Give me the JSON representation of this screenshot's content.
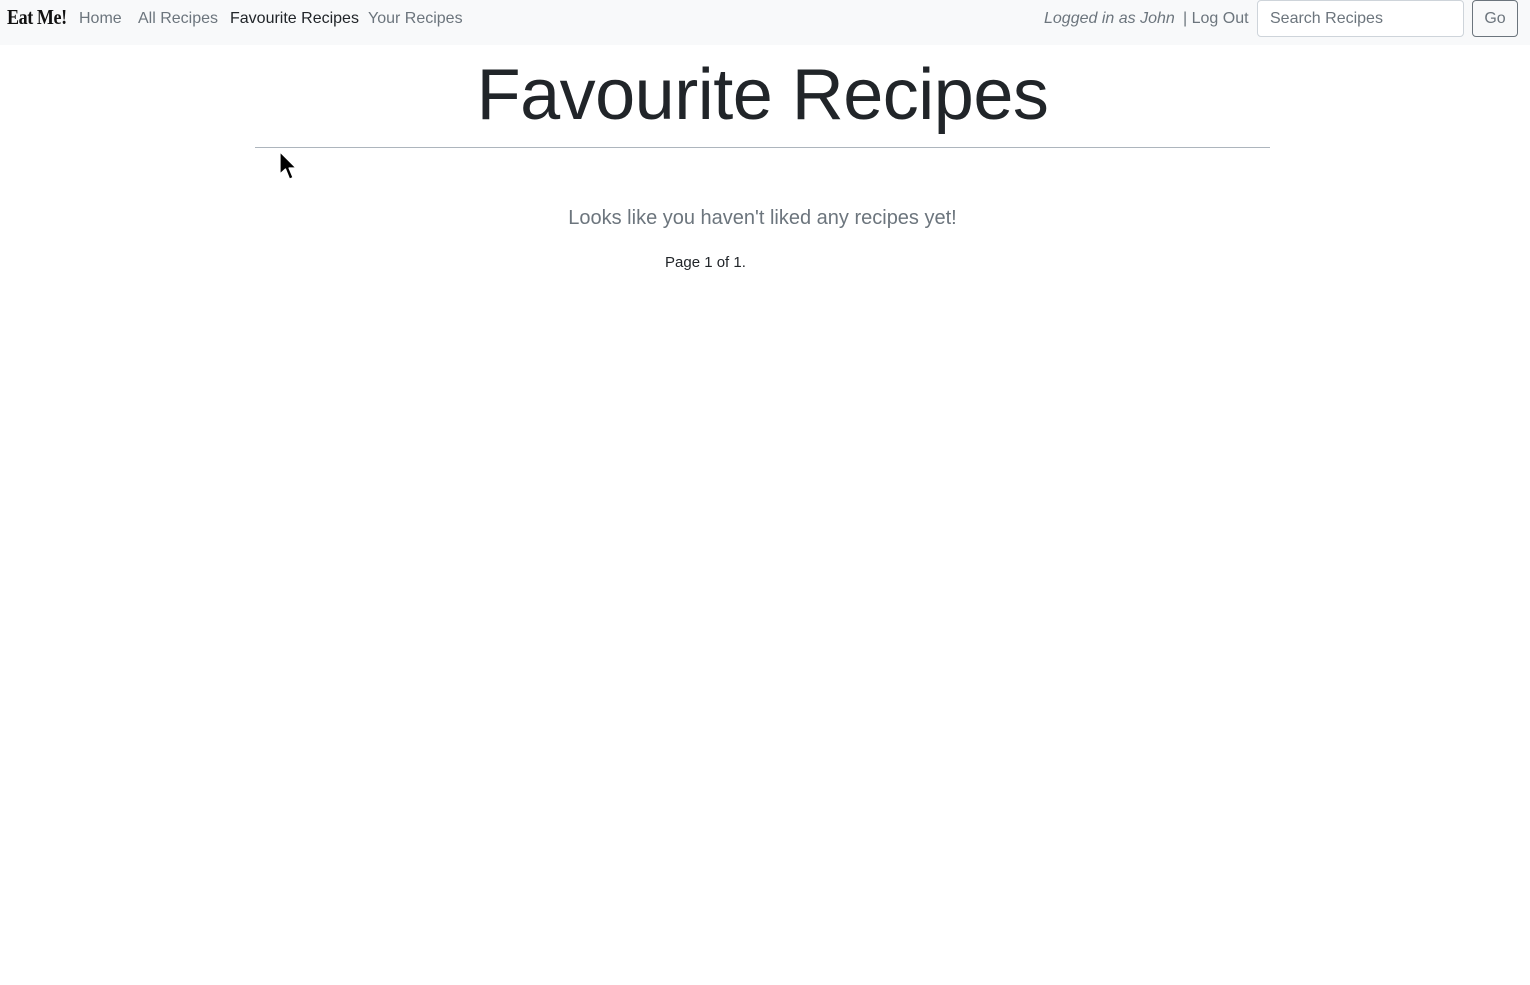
{
  "navbar": {
    "brand": "Eat Me!",
    "links": [
      {
        "label": "Home",
        "active": false
      },
      {
        "label": "All Recipes",
        "active": false
      },
      {
        "label": "Favourite Recipes",
        "active": true
      },
      {
        "label": "Your Recipes",
        "active": false
      }
    ],
    "logged_in_text": "Logged in as John",
    "logout_label": "| Log Out",
    "search_placeholder": "Search Recipes",
    "search_value": "",
    "go_label": "Go"
  },
  "main": {
    "title": "Favourite Recipes",
    "empty_message": "Looks like you haven't liked any recipes yet!",
    "pagination_text": "Page 1 of 1."
  },
  "colors": {
    "navbar_bg": "#f8f9fa",
    "muted_text": "#6c757d",
    "active_text": "#212529"
  },
  "icons": {
    "cursor": "mouse-pointer-icon"
  }
}
